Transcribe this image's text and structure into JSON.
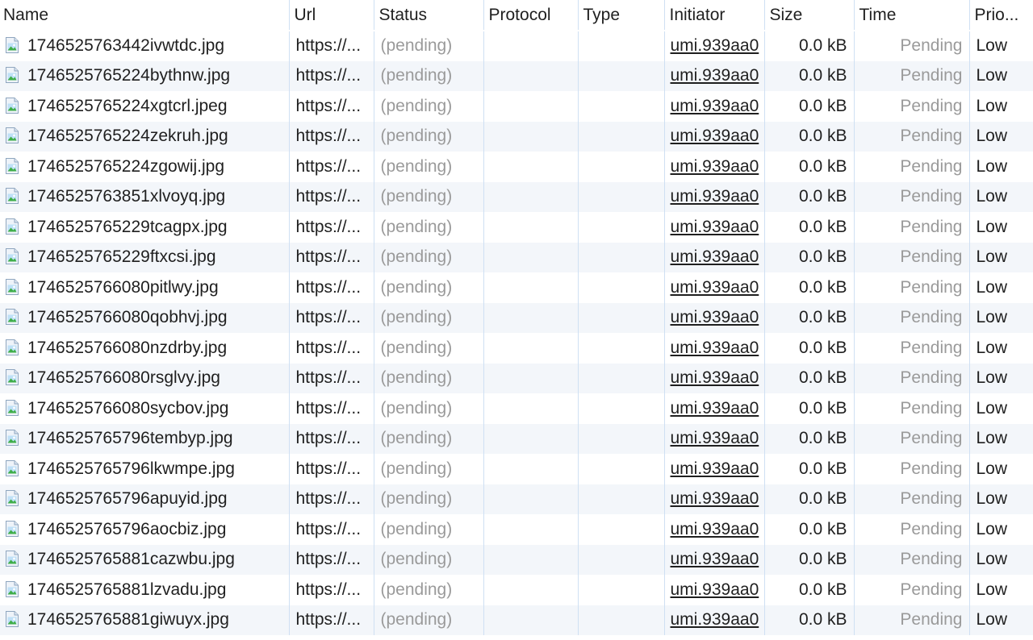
{
  "columns": {
    "name": "Name",
    "url": "Url",
    "status": "Status",
    "protocol": "Protocol",
    "type": "Type",
    "initiator": "Initiator",
    "size": "Size",
    "time": "Time",
    "priority": "Prio..."
  },
  "file_icon": "image-file-icon",
  "colors": {
    "grid_border": "#cfe0f3",
    "alt_row": "#f3f6fa",
    "muted_text": "#9a9a9a"
  },
  "rows": [
    {
      "name": "1746525763442ivwtdc.jpg",
      "url": "https://...",
      "status": "(pending)",
      "protocol": "",
      "type": "",
      "initiator": "umi.939aa0",
      "size": "0.0 kB",
      "time": "Pending",
      "priority": "Low"
    },
    {
      "name": "1746525765224bythnw.jpg",
      "url": "https://...",
      "status": "(pending)",
      "protocol": "",
      "type": "",
      "initiator": "umi.939aa0",
      "size": "0.0 kB",
      "time": "Pending",
      "priority": "Low"
    },
    {
      "name": "1746525765224xgtcrl.jpeg",
      "url": "https://...",
      "status": "(pending)",
      "protocol": "",
      "type": "",
      "initiator": "umi.939aa0",
      "size": "0.0 kB",
      "time": "Pending",
      "priority": "Low"
    },
    {
      "name": "1746525765224zekruh.jpg",
      "url": "https://...",
      "status": "(pending)",
      "protocol": "",
      "type": "",
      "initiator": "umi.939aa0",
      "size": "0.0 kB",
      "time": "Pending",
      "priority": "Low"
    },
    {
      "name": "1746525765224zgowij.jpg",
      "url": "https://...",
      "status": "(pending)",
      "protocol": "",
      "type": "",
      "initiator": "umi.939aa0",
      "size": "0.0 kB",
      "time": "Pending",
      "priority": "Low"
    },
    {
      "name": "1746525763851xlvoyq.jpg",
      "url": "https://...",
      "status": "(pending)",
      "protocol": "",
      "type": "",
      "initiator": "umi.939aa0",
      "size": "0.0 kB",
      "time": "Pending",
      "priority": "Low"
    },
    {
      "name": "1746525765229tcagpx.jpg",
      "url": "https://...",
      "status": "(pending)",
      "protocol": "",
      "type": "",
      "initiator": "umi.939aa0",
      "size": "0.0 kB",
      "time": "Pending",
      "priority": "Low"
    },
    {
      "name": "1746525765229ftxcsi.jpg",
      "url": "https://...",
      "status": "(pending)",
      "protocol": "",
      "type": "",
      "initiator": "umi.939aa0",
      "size": "0.0 kB",
      "time": "Pending",
      "priority": "Low"
    },
    {
      "name": "1746525766080pitlwy.jpg",
      "url": "https://...",
      "status": "(pending)",
      "protocol": "",
      "type": "",
      "initiator": "umi.939aa0",
      "size": "0.0 kB",
      "time": "Pending",
      "priority": "Low"
    },
    {
      "name": "1746525766080qobhvj.jpg",
      "url": "https://...",
      "status": "(pending)",
      "protocol": "",
      "type": "",
      "initiator": "umi.939aa0",
      "size": "0.0 kB",
      "time": "Pending",
      "priority": "Low"
    },
    {
      "name": "1746525766080nzdrby.jpg",
      "url": "https://...",
      "status": "(pending)",
      "protocol": "",
      "type": "",
      "initiator": "umi.939aa0",
      "size": "0.0 kB",
      "time": "Pending",
      "priority": "Low"
    },
    {
      "name": "1746525766080rsglvy.jpg",
      "url": "https://...",
      "status": "(pending)",
      "protocol": "",
      "type": "",
      "initiator": "umi.939aa0",
      "size": "0.0 kB",
      "time": "Pending",
      "priority": "Low"
    },
    {
      "name": "1746525766080sycbov.jpg",
      "url": "https://...",
      "status": "(pending)",
      "protocol": "",
      "type": "",
      "initiator": "umi.939aa0",
      "size": "0.0 kB",
      "time": "Pending",
      "priority": "Low"
    },
    {
      "name": "1746525765796tembyp.jpg",
      "url": "https://...",
      "status": "(pending)",
      "protocol": "",
      "type": "",
      "initiator": "umi.939aa0",
      "size": "0.0 kB",
      "time": "Pending",
      "priority": "Low"
    },
    {
      "name": "1746525765796lkwmpe.jpg",
      "url": "https://...",
      "status": "(pending)",
      "protocol": "",
      "type": "",
      "initiator": "umi.939aa0",
      "size": "0.0 kB",
      "time": "Pending",
      "priority": "Low"
    },
    {
      "name": "1746525765796apuyid.jpg",
      "url": "https://...",
      "status": "(pending)",
      "protocol": "",
      "type": "",
      "initiator": "umi.939aa0",
      "size": "0.0 kB",
      "time": "Pending",
      "priority": "Low"
    },
    {
      "name": "1746525765796aocbiz.jpg",
      "url": "https://...",
      "status": "(pending)",
      "protocol": "",
      "type": "",
      "initiator": "umi.939aa0",
      "size": "0.0 kB",
      "time": "Pending",
      "priority": "Low"
    },
    {
      "name": "1746525765881cazwbu.jpg",
      "url": "https://...",
      "status": "(pending)",
      "protocol": "",
      "type": "",
      "initiator": "umi.939aa0",
      "size": "0.0 kB",
      "time": "Pending",
      "priority": "Low"
    },
    {
      "name": "1746525765881lzvadu.jpg",
      "url": "https://...",
      "status": "(pending)",
      "protocol": "",
      "type": "",
      "initiator": "umi.939aa0",
      "size": "0.0 kB",
      "time": "Pending",
      "priority": "Low"
    },
    {
      "name": "1746525765881giwuyx.jpg",
      "url": "https://...",
      "status": "(pending)",
      "protocol": "",
      "type": "",
      "initiator": "umi.939aa0",
      "size": "0.0 kB",
      "time": "Pending",
      "priority": "Low"
    }
  ]
}
